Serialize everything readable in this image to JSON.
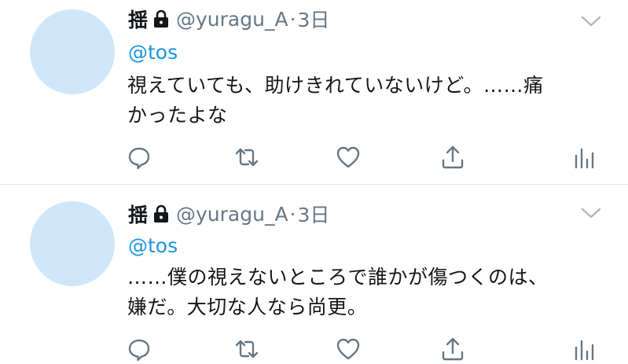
{
  "tweets": [
    {
      "display_name": "揺",
      "handle": "@yuragu_A",
      "separator": "·",
      "time": "3日",
      "reply_to": "@tos",
      "lines": [
        "視えていても、助けきれていないけど。……痛",
        "かったよな"
      ]
    },
    {
      "display_name": "揺",
      "handle": "@yuragu_A",
      "separator": "·",
      "time": "3日",
      "reply_to": "@tos",
      "lines": [
        "……僕の視えないところで誰かが傷つくのは、",
        "嫌だ。大切な人なら尚更。"
      ]
    }
  ],
  "colors": {
    "text": "#14171a",
    "secondary": "#657786",
    "link": "#1b95e0",
    "avatar": "#d0e7f9",
    "divider": "#e1e8ed"
  },
  "icons": [
    "lock-icon",
    "chevron-down-icon",
    "reply-icon",
    "retweet-icon",
    "like-icon",
    "share-icon",
    "analytics-icon"
  ]
}
